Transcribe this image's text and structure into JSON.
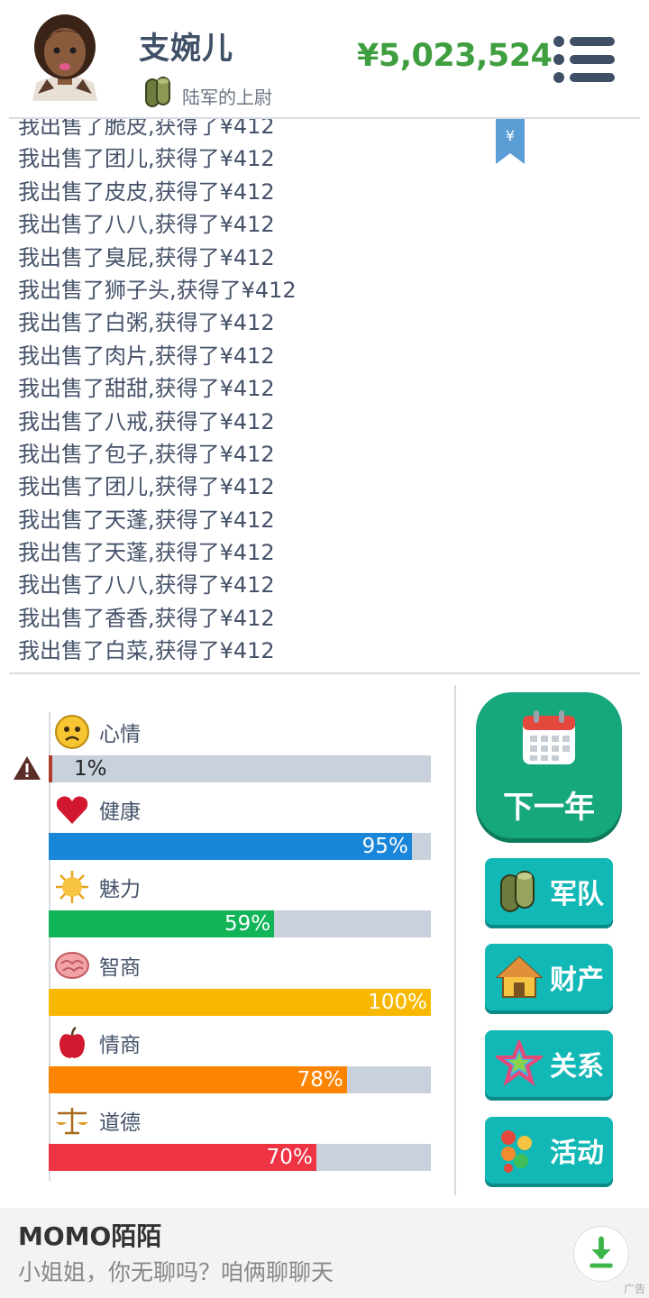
{
  "header": {
    "name": "支婉儿",
    "rank": "陆军的上尉",
    "money": "¥5,023,524"
  },
  "log": [
    "我出售了脆皮,获得了¥412",
    "我出售了团儿,获得了¥412",
    "我出售了皮皮,获得了¥412",
    "我出售了八八,获得了¥412",
    "我出售了臭屁,获得了¥412",
    "我出售了狮子头,获得了¥412",
    "我出售了白粥,获得了¥412",
    "我出售了肉片,获得了¥412",
    "我出售了甜甜,获得了¥412",
    "我出售了八戒,获得了¥412",
    "我出售了包子,获得了¥412",
    "我出售了团儿,获得了¥412",
    "我出售了天蓬,获得了¥412",
    "我出售了天蓬,获得了¥412",
    "我出售了八八,获得了¥412",
    "我出售了香香,获得了¥412",
    "我出售了白菜,获得了¥412"
  ],
  "stats": [
    {
      "label": "心情",
      "pct_text": "1%",
      "value": 1,
      "color": "#b23a2e",
      "icon": "sad-face-icon"
    },
    {
      "label": "健康",
      "pct_text": "95%",
      "value": 95,
      "color": "#1a86d9",
      "icon": "heart-icon"
    },
    {
      "label": "魅力",
      "pct_text": "59%",
      "value": 59,
      "color": "#11b558",
      "icon": "sun-icon"
    },
    {
      "label": "智商",
      "pct_text": "100%",
      "value": 100,
      "color": "#f9b800",
      "icon": "brain-icon"
    },
    {
      "label": "情商",
      "pct_text": "78%",
      "value": 78,
      "color": "#fb8500",
      "icon": "apple-icon"
    },
    {
      "label": "道德",
      "pct_text": "70%",
      "value": 70,
      "color": "#ee3344",
      "icon": "scales-icon"
    }
  ],
  "actions": {
    "next_year": "下一年",
    "army": "军队",
    "property": "财产",
    "relations": "关系",
    "activities": "活动"
  },
  "ad": {
    "title": "MOMO陌陌",
    "subtitle": "小姐姐，你无聊吗？咱俩聊聊天",
    "badge": "广告"
  },
  "colors": {
    "money": "#3f9e3f",
    "primary_button": "#16a77d",
    "side_button": "#12b8b6"
  }
}
